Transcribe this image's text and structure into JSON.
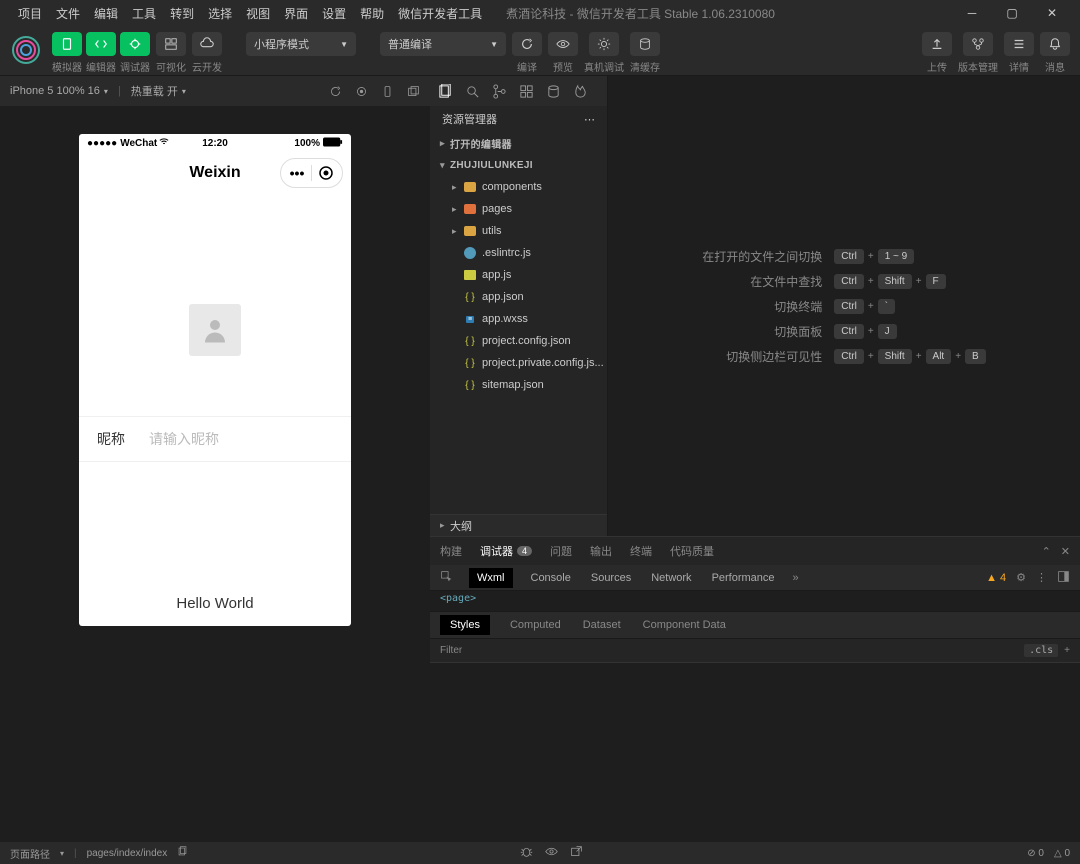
{
  "titlebar": {
    "menu": [
      "项目",
      "文件",
      "编辑",
      "工具",
      "转到",
      "选择",
      "视图",
      "界面",
      "设置",
      "帮助",
      "微信开发者工具"
    ],
    "title": "煮酒论科技 - 微信开发者工具 Stable 1.06.2310080"
  },
  "toolbar": {
    "tabs": {
      "sim": "模拟器",
      "editor": "编辑器",
      "debugger": "调试器",
      "viz": "可视化",
      "cloud": "云开发"
    },
    "mode_select": "小程序模式",
    "compile_select": "普通编译",
    "actions": {
      "compile": "编译",
      "preview": "预览",
      "remote": "真机调试",
      "cache": "清缓存",
      "upload": "上传",
      "vcs": "版本管理",
      "details": "详情",
      "notify": "消息"
    }
  },
  "simulator": {
    "device": "iPhone 5 100% 16",
    "reload": "热重载 开",
    "status": {
      "carrier": "WeChat",
      "time": "12:20",
      "battery": "100%"
    },
    "nav_title": "Weixin",
    "nickname_label": "昵称",
    "nickname_placeholder": "请输入昵称",
    "hello": "Hello World"
  },
  "explorer": {
    "title": "资源管理器",
    "sections": {
      "open_editors": "打开的编辑器",
      "project": "ZHUJIULUNKEJI"
    },
    "tree": [
      {
        "type": "folder",
        "name": "components",
        "color": "yellow"
      },
      {
        "type": "folder",
        "name": "pages",
        "color": "orange"
      },
      {
        "type": "folder",
        "name": "utils",
        "color": "yellow"
      },
      {
        "type": "file",
        "name": ".eslintrc.js",
        "icon": "js"
      },
      {
        "type": "file",
        "name": "app.js",
        "icon": "js-y"
      },
      {
        "type": "file",
        "name": "app.json",
        "icon": "json"
      },
      {
        "type": "file",
        "name": "app.wxss",
        "icon": "wxss"
      },
      {
        "type": "file",
        "name": "project.config.json",
        "icon": "json"
      },
      {
        "type": "file",
        "name": "project.private.config.js...",
        "icon": "json"
      },
      {
        "type": "file",
        "name": "sitemap.json",
        "icon": "json"
      }
    ],
    "outline": "大纲"
  },
  "hints": [
    {
      "label": "在打开的文件之间切换",
      "keys": [
        "Ctrl",
        "1 ~ 9"
      ]
    },
    {
      "label": "在文件中查找",
      "keys": [
        "Ctrl",
        "Shift",
        "F"
      ]
    },
    {
      "label": "切换终端",
      "keys": [
        "Ctrl",
        "`"
      ]
    },
    {
      "label": "切换面板",
      "keys": [
        "Ctrl",
        "J"
      ]
    },
    {
      "label": "切换侧边栏可见性",
      "keys": [
        "Ctrl",
        "Shift",
        "Alt",
        "B"
      ]
    }
  ],
  "debugger": {
    "tabs": [
      {
        "label": "构建",
        "active": false
      },
      {
        "label": "调试器",
        "badge": "4",
        "active": true
      },
      {
        "label": "问题",
        "active": false
      },
      {
        "label": "输出",
        "active": false
      },
      {
        "label": "终端",
        "active": false
      },
      {
        "label": "代码质量",
        "active": false
      }
    ],
    "devtools_tabs": [
      "Wxml",
      "Console",
      "Sources",
      "Network",
      "Performance"
    ],
    "devtools_active": "Wxml",
    "warn_count": "4",
    "markup_hint": "<page>",
    "styles_tabs": [
      "Styles",
      "Computed",
      "Dataset",
      "Component Data"
    ],
    "styles_active": "Styles",
    "filter_placeholder": "Filter",
    "cls": ".cls"
  },
  "statusbar": {
    "path_label": "页面路径",
    "path": "pages/index/index",
    "errors": "0",
    "warnings": "0"
  }
}
